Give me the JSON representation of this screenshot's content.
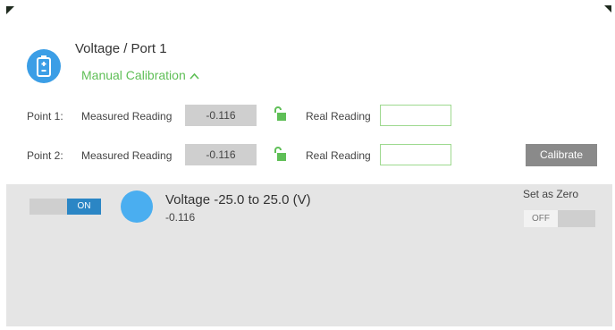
{
  "header": {
    "title": "Voltage / Port 1",
    "calibration_toggle_label": "Manual Calibration",
    "calibration_toggle_icon": "chevron-up-icon",
    "sensor_icon": "battery-icon",
    "accent_color": "#5fbf57",
    "icon_color": "#3b9ee6"
  },
  "calibration": {
    "points": [
      {
        "label": "Point 1:",
        "measured_label": "Measured Reading",
        "measured_value": "-0.116",
        "lock_icon": "unlock-icon",
        "real_label": "Real Reading",
        "real_value": ""
      },
      {
        "label": "Point 2:",
        "measured_label": "Measured Reading",
        "measured_value": "-0.116",
        "lock_icon": "unlock-icon",
        "real_label": "Real Reading",
        "real_value": ""
      }
    ],
    "calibrate_label": "Calibrate"
  },
  "sensor": {
    "switch_label": "ON",
    "switch_color": "#2b86c5",
    "name": "Voltage -25.0 to 25.0 (V)",
    "value": "-0.116",
    "dot_color": "#4aaef0",
    "set_zero_label": "Set as Zero",
    "zero_switch_label": "OFF"
  }
}
